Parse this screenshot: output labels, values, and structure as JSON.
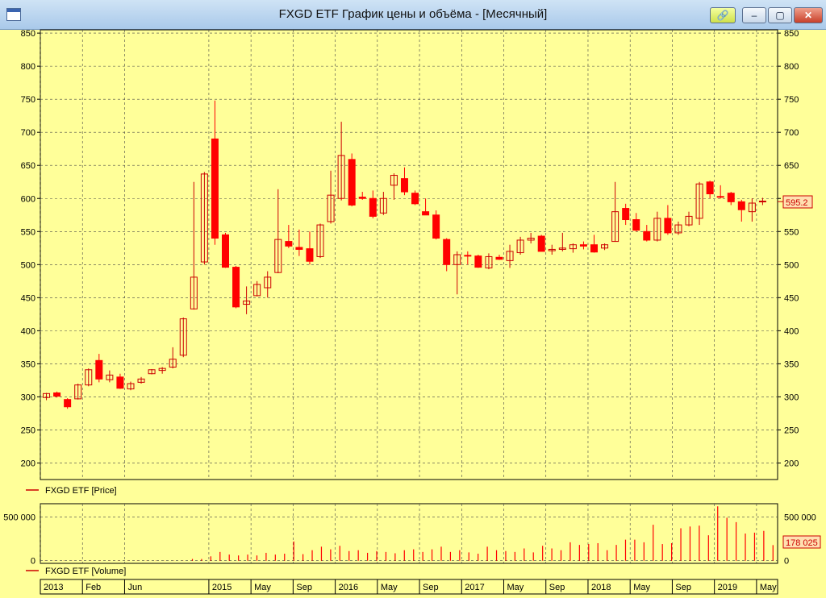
{
  "window": {
    "title": "FXGD ETF График цены и объёма - [Месячный]",
    "buttons": {
      "link": "🔗",
      "minimize": "–",
      "maximize": "▢",
      "close": "✕"
    }
  },
  "colors": {
    "background": "#ffff99",
    "up": "#cc0000",
    "down": "#ff0000",
    "grid": "#444444",
    "badge": "#ffe0b0"
  },
  "chart_data": [
    {
      "type": "candlestick",
      "name": "price",
      "legend": "FXGD ETF [Price]",
      "ylim": [
        175,
        855
      ],
      "yticks": [
        200,
        250,
        300,
        350,
        400,
        450,
        500,
        550,
        600,
        650,
        700,
        750,
        800,
        850
      ],
      "last_value_label": "595.2",
      "last_value": 595.2,
      "candles": [
        {
          "o": 299,
          "h": 306,
          "l": 295,
          "c": 305
        },
        {
          "o": 306,
          "h": 308,
          "l": 299,
          "c": 301
        },
        {
          "o": 296,
          "h": 298,
          "l": 282,
          "c": 285
        },
        {
          "o": 297,
          "h": 320,
          "l": 296,
          "c": 318
        },
        {
          "o": 318,
          "h": 343,
          "l": 316,
          "c": 341
        },
        {
          "o": 355,
          "h": 365,
          "l": 322,
          "c": 327
        },
        {
          "o": 326,
          "h": 340,
          "l": 322,
          "c": 333
        },
        {
          "o": 330,
          "h": 335,
          "l": 312,
          "c": 313
        },
        {
          "o": 312,
          "h": 323,
          "l": 310,
          "c": 320
        },
        {
          "o": 322,
          "h": 330,
          "l": 320,
          "c": 327
        },
        {
          "o": 335,
          "h": 342,
          "l": 334,
          "c": 341
        },
        {
          "o": 340,
          "h": 345,
          "l": 335,
          "c": 343
        },
        {
          "o": 345,
          "h": 375,
          "l": 343,
          "c": 357
        },
        {
          "o": 363,
          "h": 420,
          "l": 360,
          "c": 418
        },
        {
          "o": 433,
          "h": 625,
          "l": 432,
          "c": 481
        },
        {
          "o": 504,
          "h": 640,
          "l": 500,
          "c": 637
        },
        {
          "o": 690,
          "h": 748,
          "l": 530,
          "c": 540
        },
        {
          "o": 545,
          "h": 548,
          "l": 495,
          "c": 496
        },
        {
          "o": 496,
          "h": 498,
          "l": 434,
          "c": 436
        },
        {
          "o": 440,
          "h": 467,
          "l": 425,
          "c": 445
        },
        {
          "o": 453,
          "h": 475,
          "l": 452,
          "c": 470
        },
        {
          "o": 465,
          "h": 490,
          "l": 450,
          "c": 481
        },
        {
          "o": 488,
          "h": 614,
          "l": 487,
          "c": 538
        },
        {
          "o": 535,
          "h": 560,
          "l": 525,
          "c": 528
        },
        {
          "o": 526,
          "h": 553,
          "l": 513,
          "c": 523
        },
        {
          "o": 524,
          "h": 550,
          "l": 500,
          "c": 505
        },
        {
          "o": 512,
          "h": 562,
          "l": 510,
          "c": 560
        },
        {
          "o": 565,
          "h": 642,
          "l": 562,
          "c": 605
        },
        {
          "o": 600,
          "h": 716,
          "l": 597,
          "c": 665
        },
        {
          "o": 659,
          "h": 668,
          "l": 588,
          "c": 590
        },
        {
          "o": 602,
          "h": 610,
          "l": 598,
          "c": 600
        },
        {
          "o": 600,
          "h": 612,
          "l": 570,
          "c": 573
        },
        {
          "o": 578,
          "h": 610,
          "l": 575,
          "c": 600
        },
        {
          "o": 620,
          "h": 638,
          "l": 598,
          "c": 635
        },
        {
          "o": 630,
          "h": 647,
          "l": 605,
          "c": 610
        },
        {
          "o": 608,
          "h": 612,
          "l": 590,
          "c": 592
        },
        {
          "o": 580,
          "h": 600,
          "l": 575,
          "c": 575
        },
        {
          "o": 575,
          "h": 582,
          "l": 538,
          "c": 540
        },
        {
          "o": 538,
          "h": 540,
          "l": 490,
          "c": 500
        },
        {
          "o": 500,
          "h": 520,
          "l": 455,
          "c": 515
        },
        {
          "o": 514,
          "h": 520,
          "l": 500,
          "c": 513
        },
        {
          "o": 513,
          "h": 515,
          "l": 495,
          "c": 496
        },
        {
          "o": 495,
          "h": 517,
          "l": 493,
          "c": 512
        },
        {
          "o": 511,
          "h": 515,
          "l": 507,
          "c": 508
        },
        {
          "o": 506,
          "h": 530,
          "l": 495,
          "c": 520
        },
        {
          "o": 518,
          "h": 542,
          "l": 515,
          "c": 537
        },
        {
          "o": 537,
          "h": 548,
          "l": 532,
          "c": 540
        },
        {
          "o": 543,
          "h": 545,
          "l": 520,
          "c": 520
        },
        {
          "o": 521,
          "h": 530,
          "l": 515,
          "c": 523
        },
        {
          "o": 523,
          "h": 548,
          "l": 520,
          "c": 525
        },
        {
          "o": 524,
          "h": 532,
          "l": 518,
          "c": 530
        },
        {
          "o": 530,
          "h": 535,
          "l": 523,
          "c": 528
        },
        {
          "o": 530,
          "h": 545,
          "l": 518,
          "c": 519
        },
        {
          "o": 525,
          "h": 532,
          "l": 522,
          "c": 530
        },
        {
          "o": 535,
          "h": 625,
          "l": 535,
          "c": 580
        },
        {
          "o": 585,
          "h": 592,
          "l": 560,
          "c": 568
        },
        {
          "o": 568,
          "h": 578,
          "l": 550,
          "c": 552
        },
        {
          "o": 550,
          "h": 560,
          "l": 535,
          "c": 537
        },
        {
          "o": 537,
          "h": 580,
          "l": 535,
          "c": 570
        },
        {
          "o": 570,
          "h": 590,
          "l": 545,
          "c": 548
        },
        {
          "o": 548,
          "h": 565,
          "l": 545,
          "c": 560
        },
        {
          "o": 560,
          "h": 580,
          "l": 558,
          "c": 573
        },
        {
          "o": 570,
          "h": 625,
          "l": 560,
          "c": 622
        },
        {
          "o": 625,
          "h": 627,
          "l": 600,
          "c": 607
        },
        {
          "o": 603,
          "h": 620,
          "l": 600,
          "c": 602
        },
        {
          "o": 608,
          "h": 610,
          "l": 590,
          "c": 595
        },
        {
          "o": 595,
          "h": 598,
          "l": 565,
          "c": 583
        },
        {
          "o": 580,
          "h": 600,
          "l": 565,
          "c": 593
        },
        {
          "o": 595,
          "h": 601,
          "l": 590,
          "c": 596
        }
      ]
    },
    {
      "type": "bar",
      "name": "volume",
      "legend": "FXGD ETF [Volume]",
      "ylim": [
        -30000,
        650000
      ],
      "yticks": [
        0,
        500000
      ],
      "ytick_labels": [
        "0",
        "500 000"
      ],
      "last_value_label": "178 025",
      "last_value": 178025,
      "values": [
        2000,
        2000,
        2000,
        2000,
        2000,
        2000,
        2000,
        2000,
        2000,
        2000,
        2000,
        2000,
        2000,
        2000,
        2000,
        2000,
        20000,
        20000,
        50000,
        100000,
        70000,
        60000,
        70000,
        60000,
        90000,
        70000,
        80000,
        220000,
        75000,
        120000,
        160000,
        130000,
        170000,
        110000,
        120000,
        90000,
        110000,
        100000,
        85000,
        120000,
        130000,
        100000,
        130000,
        160000,
        100000,
        120000,
        95000,
        80000,
        160000,
        120000,
        110000,
        100000,
        140000,
        95000,
        170000,
        140000,
        120000,
        210000,
        180000,
        190000,
        200000,
        120000,
        180000,
        240000,
        240000,
        210000,
        410000,
        190000,
        200000,
        370000,
        390000,
        400000,
        290000,
        620000,
        490000,
        440000,
        310000,
        320000,
        340000,
        178025
      ]
    }
  ],
  "x_axis": {
    "labels": [
      {
        "i": 0,
        "text": "2013"
      },
      {
        "i": 4,
        "text": "Feb"
      },
      {
        "i": 8,
        "text": "Jun"
      },
      {
        "i": 16,
        "text": "2015"
      },
      {
        "i": 20,
        "text": "May"
      },
      {
        "i": 24,
        "text": "Sep"
      },
      {
        "i": 28,
        "text": "2016"
      },
      {
        "i": 32,
        "text": "May"
      },
      {
        "i": 36,
        "text": "Sep"
      },
      {
        "i": 40,
        "text": "2017"
      },
      {
        "i": 44,
        "text": "May"
      },
      {
        "i": 48,
        "text": "Sep"
      },
      {
        "i": 52,
        "text": "2018"
      },
      {
        "i": 56,
        "text": "May"
      },
      {
        "i": 60,
        "text": "Sep"
      },
      {
        "i": 64,
        "text": "2019"
      },
      {
        "i": 68,
        "text": "May"
      }
    ]
  }
}
